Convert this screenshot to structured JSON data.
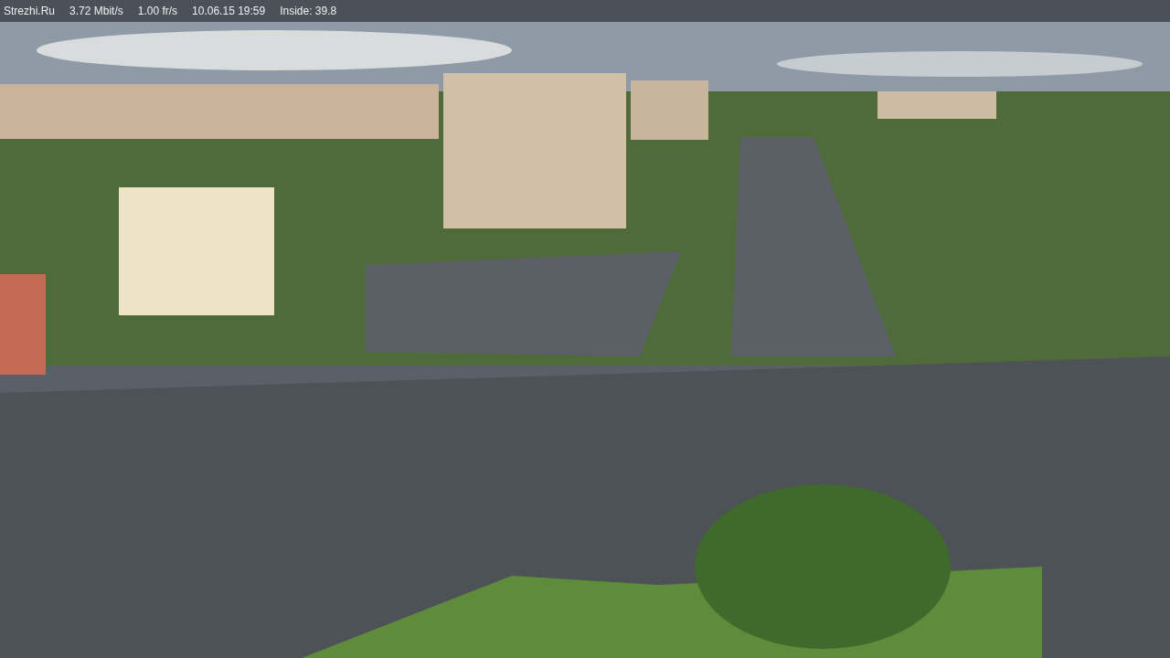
{
  "status_bar": {
    "items": [
      "Strezhi.Ru",
      "3.72 Mbit/s",
      "1.00 fr/s",
      "10.06.15 19:59",
      "Inside: 39.8"
    ]
  }
}
